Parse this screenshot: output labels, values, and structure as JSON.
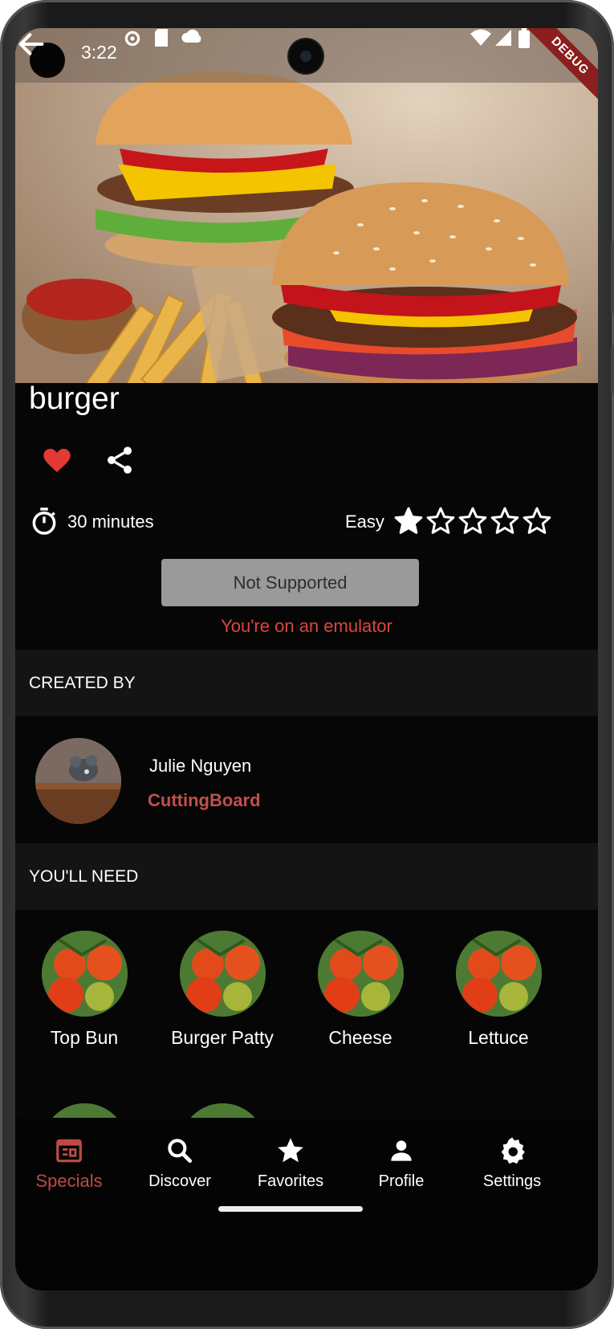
{
  "status_bar": {
    "time": "3:22",
    "debug_label": "DEBUG"
  },
  "recipe": {
    "title": "burger",
    "time_label": "30 minutes",
    "difficulty": "Easy",
    "rating": 1,
    "rating_max": 5,
    "button_label": "Not Supported",
    "notice": "You're on an emulator"
  },
  "created_by": {
    "heading": "CREATED BY",
    "name": "Julie Nguyen",
    "brand": "CuttingBoard"
  },
  "ingredients": {
    "heading": "YOU'LL NEED",
    "items": [
      {
        "label": "Top Bun"
      },
      {
        "label": "Burger Patty"
      },
      {
        "label": "Cheese"
      },
      {
        "label": "Lettuce"
      }
    ]
  },
  "nav": {
    "items": [
      {
        "label": "Specials",
        "icon": "specials-icon",
        "active": true
      },
      {
        "label": "Discover",
        "icon": "search-icon"
      },
      {
        "label": "Favorites",
        "icon": "star-icon"
      },
      {
        "label": "Profile",
        "icon": "person-icon"
      },
      {
        "label": "Settings",
        "icon": "gear-icon"
      }
    ]
  },
  "colors": {
    "accent": "#bf4a45",
    "heart": "#e53935",
    "notice": "#d9463d",
    "background": "#060606",
    "section_header": "#141414"
  }
}
